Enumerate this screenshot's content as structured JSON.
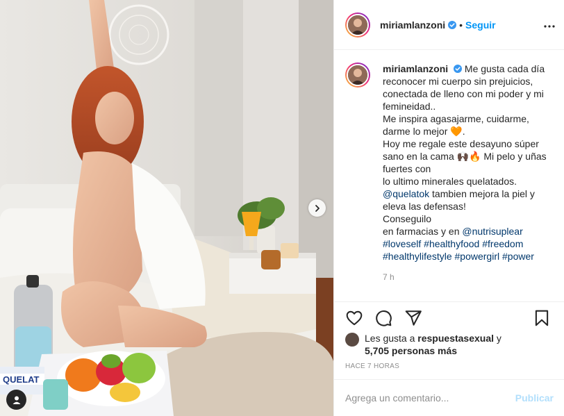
{
  "header": {
    "username": "miriamlanzoni",
    "separator": "•",
    "follow_label": "Seguir"
  },
  "caption": {
    "username": "miriamlanzoni",
    "line1": "Me gusta cada día reconocer mi cuerpo sin prejuicios, conectada de lleno con mi poder y mi femineidad..",
    "line2": "Me inspira agasajarme, cuidarme, darme lo mejor",
    "emoji_heart": "🧡",
    "line3": "Hoy me regale este desayuno súper sano en la cama",
    "emoji_hands_fire": "🙌🏿🔥",
    "line4": "Mi pelo y uñas fuertes con",
    "line5": "lo ultimo minerales quelatados.",
    "mention1": "@quelatok",
    "line6": "tambien mejora la piel y eleva las defensas!",
    "line7": "Conseguilo",
    "line8_prefix": "en farmacias y en",
    "mention2": "@nutrisuplear",
    "hashtags_row1": [
      "#loveself",
      "#healthyfood",
      "#freedom"
    ],
    "hashtags_row2": [
      "#healthylifestyle",
      "#powergirl",
      "#power"
    ],
    "time_ago": "7 h"
  },
  "actions": {
    "like": "heart-icon",
    "comment": "comment-icon",
    "share": "share-icon",
    "save": "bookmark-icon"
  },
  "likes": {
    "prefix": "Les gusta a",
    "user": "respuestasexual",
    "connector": "y",
    "count": "5,705 personas más"
  },
  "timestamp": "HACE 7 HORAS",
  "comment": {
    "placeholder": "Agrega un comentario...",
    "post_label": "Publicar"
  },
  "photo": {
    "product_label": "QUELAT"
  },
  "colors": {
    "link": "#0095f6",
    "hashtag": "#00376b",
    "muted": "#8e8e8e",
    "post_disabled": "#b2dffc"
  }
}
